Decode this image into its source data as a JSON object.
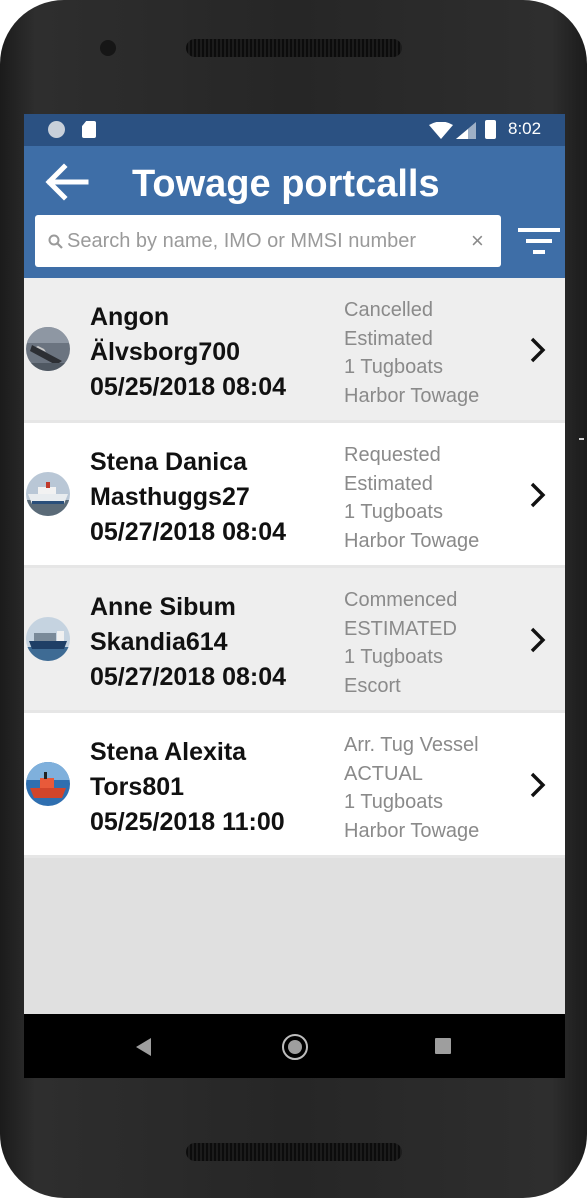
{
  "status_bar": {
    "time": "8:02"
  },
  "app_bar": {
    "title": "Towage portcalls",
    "back_icon": "arrow-left-icon",
    "filter_icon": "filter-icon"
  },
  "search": {
    "placeholder": "Search by name, IMO or MMSI number",
    "value": "",
    "clear_label": "×"
  },
  "portcalls": [
    {
      "name": "Angon",
      "berth": "Älvsborg700",
      "datetime": "05/25/2018 08:04",
      "status": "Cancelled",
      "time_type": "Estimated",
      "tugboats": "1 Tugboats",
      "service": "Harbor Towage",
      "avatar": "ship-photo-icon"
    },
    {
      "name": "Stena Danica",
      "berth": "Masthuggs27",
      "datetime": "05/27/2018 08:04",
      "status": "Requested",
      "time_type": "Estimated",
      "tugboats": "1 Tugboats",
      "service": "Harbor Towage",
      "avatar": "ship-photo-icon"
    },
    {
      "name": "Anne Sibum",
      "berth": "Skandia614",
      "datetime": "05/27/2018 08:04",
      "status": "Commenced",
      "time_type": "ESTIMATED",
      "tugboats": "1 Tugboats",
      "service": "Escort",
      "avatar": "ship-photo-icon"
    },
    {
      "name": "Stena Alexita",
      "berth": "Tors801",
      "datetime": "05/25/2018 11:00",
      "status": "Arr. Tug Vessel",
      "time_type": "ACTUAL",
      "tugboats": "1 Tugboats",
      "service": "Harbor Towage",
      "avatar": "ship-photo-icon"
    }
  ],
  "colors": {
    "status_bar": "#2b5182",
    "app_bar": "#3e6ea7",
    "row_alt": "#eeeeee",
    "secondary_text": "#8a8a8a"
  }
}
